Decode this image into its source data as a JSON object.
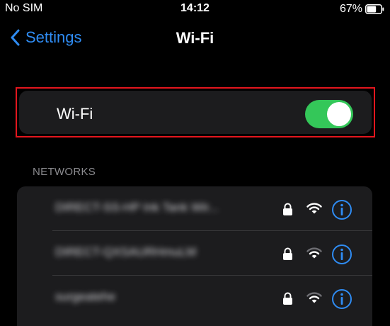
{
  "status_bar": {
    "carrier": "No SIM",
    "time": "14:12",
    "battery_percent": "67%",
    "battery_level": 0.67
  },
  "nav": {
    "back_label": "Settings",
    "title": "Wi-Fi"
  },
  "wifi_toggle": {
    "label": "Wi-Fi",
    "on": true,
    "on_color": "#34c759",
    "highlight_color": "#e3161e"
  },
  "networks": {
    "header": "NETWORKS",
    "items": [
      {
        "name": "DIRECT-SS-HP Ink Tank Wir...",
        "secured": true,
        "icon": "wifi-icon",
        "signal_bars": 3
      },
      {
        "name": "DIRECT-QXSAURHmuLM",
        "secured": true,
        "icon": "wifi-icon",
        "signal_bars": 2
      },
      {
        "name": "surgeatehe",
        "secured": true,
        "icon": "wifi-icon",
        "signal_bars": 2
      }
    ]
  },
  "colors": {
    "accent": "#2f8cf3",
    "background": "#000000",
    "cell": "#1c1c1e"
  }
}
